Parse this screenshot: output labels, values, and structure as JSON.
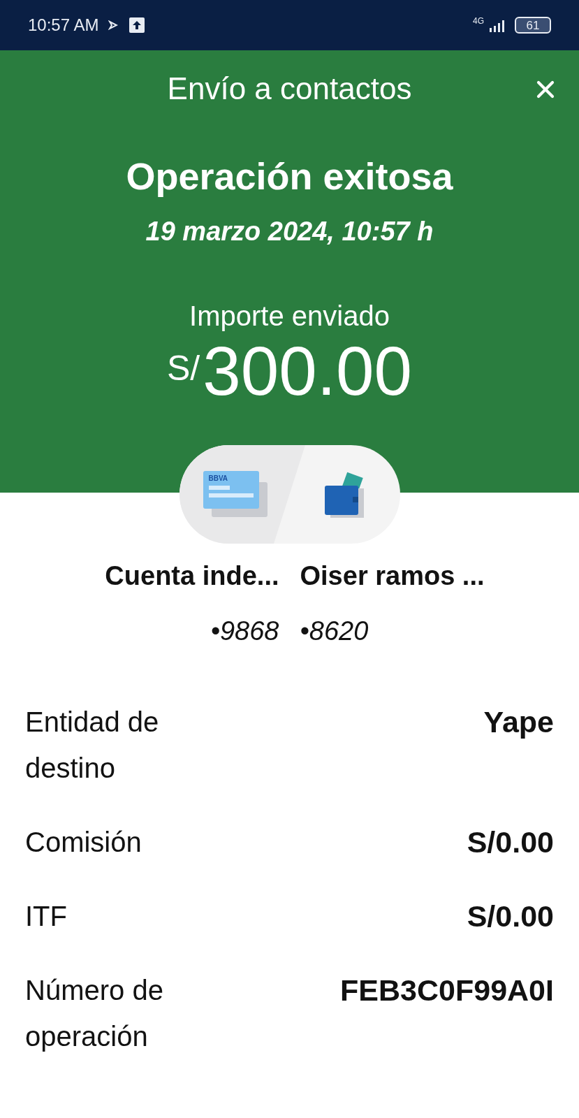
{
  "status_bar": {
    "time": "10:57 AM",
    "network": "4G",
    "battery": "61"
  },
  "header": {
    "title": "Envío a contactos",
    "heading": "Operación exitosa",
    "date": "19 marzo 2024, 10:57 h",
    "amount_label": "Importe enviado",
    "currency": "S/",
    "amount": "300.00"
  },
  "transfer": {
    "card_logo": "BBVA",
    "from": {
      "name": "Cuenta inde...",
      "number": "•9868"
    },
    "to": {
      "name": "Oiser ramos ...",
      "number": "•8620"
    }
  },
  "details": [
    {
      "label": "Entidad de destino",
      "value": "Yape"
    },
    {
      "label": "Comisión",
      "value": "S/0.00"
    },
    {
      "label": "ITF",
      "value": "S/0.00"
    },
    {
      "label": "Número de operación",
      "value": "FEB3C0F99A0I"
    }
  ]
}
